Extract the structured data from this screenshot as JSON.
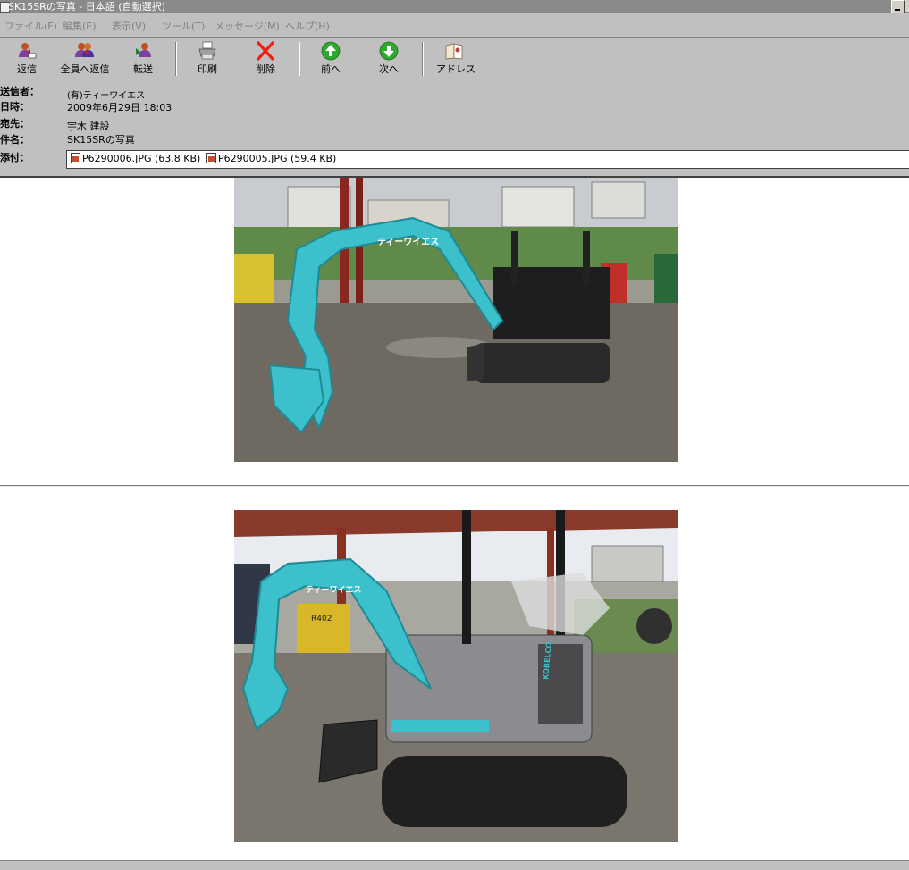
{
  "window": {
    "title": "SK15SRの写真 - 日本語 (自動選択)"
  },
  "menu": [
    "ファイル(F)",
    "編集(E)",
    "表示(V)",
    "ツール(T)",
    "メッセージ(M)",
    "ヘルプ(H)"
  ],
  "toolbar": {
    "reply": "返信",
    "reply_all": "全員へ返信",
    "forward": "転送",
    "print": "印刷",
    "delete": "削除",
    "previous": "前へ",
    "next": "次へ",
    "addresses": "アドレス"
  },
  "header": {
    "from_label": "送信者：",
    "from_value": "(有)ティーワイエス",
    "date_label": "日時：",
    "date_value": "2009年6月29日 18:03",
    "to_label": "宛先：",
    "to_value": "宇木 建設",
    "subject_label": "件名：",
    "subject_value": "SK15SRの写真",
    "attach_label": "添付："
  },
  "attachments": [
    {
      "name": "P6290006.JPG (63.8 KB)"
    },
    {
      "name": "P6290005.JPG (59.4 KB)"
    }
  ],
  "photos": {
    "photo1_sign": "ティーワイエス",
    "photo2_sign": "ティーワイエス",
    "photo2_plate": "R402",
    "photo2_brand": "KOBELCO"
  },
  "colors": {
    "chrome": "#c0c0c0",
    "excavator_cyan": "#3cc0cc",
    "title_bar": "#8a8a8a"
  }
}
